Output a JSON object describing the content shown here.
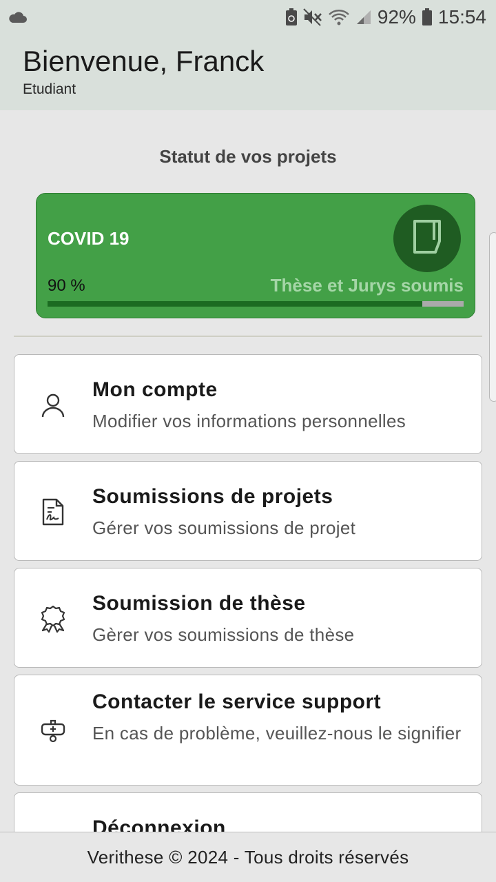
{
  "status_bar": {
    "battery_percent": "92%",
    "time": "15:54",
    "icons": [
      "cloud-icon",
      "recycle-icon",
      "mute-icon",
      "wifi-icon",
      "signal-icon",
      "battery-icon"
    ]
  },
  "header": {
    "welcome": "Bienvenue, Franck",
    "role": "Etudiant"
  },
  "projects_section": {
    "title": "Statut de vos projets",
    "projects": [
      {
        "name": "COVID 19",
        "percent_label": "90 %",
        "progress": 0.9,
        "status": "Thèse et Jurys soumis",
        "icon": "document-icon"
      }
    ]
  },
  "menu": [
    {
      "title": "Mon compte",
      "subtitle": "Modifier vos informations personnelles",
      "icon": "user-icon"
    },
    {
      "title": "Soumissions de projets",
      "subtitle": "Gérer vos soumissions de projet",
      "icon": "file-signature-icon"
    },
    {
      "title": "Soumission de thèse",
      "subtitle": "Gèrer vos soumissions de thèse",
      "icon": "award-icon"
    },
    {
      "title": "Contacter le service support",
      "subtitle": "En cas de problème, veuillez-nous le signifier",
      "icon": "support-icon"
    },
    {
      "title": "Déconnexion",
      "subtitle": "",
      "icon": "logout-icon"
    }
  ],
  "footer": {
    "text": "Verithese © 2024 - Tous droits réservés"
  },
  "colors": {
    "header_bg": "#d9e0db",
    "card_green": "#43a047",
    "icon_circle": "#1f5c22",
    "progress_fill": "#1b6b21",
    "status_text": "#a5d6a7"
  }
}
